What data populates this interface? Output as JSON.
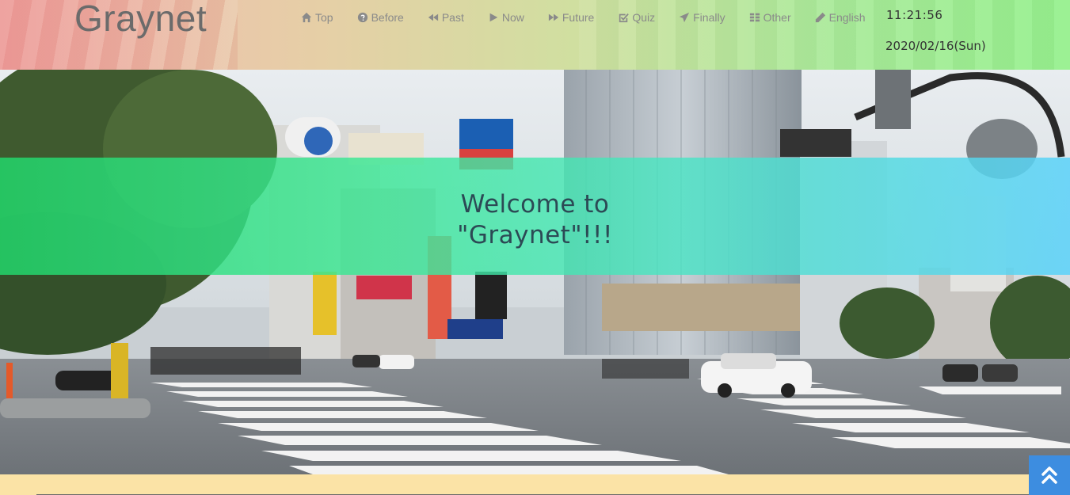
{
  "header": {
    "logo": "Graynet",
    "nav": [
      {
        "label": "Top",
        "icon": "home-icon"
      },
      {
        "label": "Before",
        "icon": "question-circle-icon"
      },
      {
        "label": "Past",
        "icon": "backward-icon"
      },
      {
        "label": "Now",
        "icon": "play-icon"
      },
      {
        "label": "Future",
        "icon": "forward-icon"
      },
      {
        "label": "Quiz",
        "icon": "checkbox-icon"
      },
      {
        "label": "Finally",
        "icon": "send-icon"
      },
      {
        "label": "Other",
        "icon": "grid-icon"
      },
      {
        "label": "English",
        "icon": "pencil-icon"
      }
    ],
    "time": "11:21:56",
    "date": "2020/02/16(Sun)"
  },
  "hero": {
    "line1": "Welcome to",
    "line2": "\"Graynet\"!!!"
  },
  "scroll_top": {
    "icon": "double-chevron-up-icon"
  },
  "colors": {
    "to_top_button": "#3d8de0",
    "footer": "#fbe3a6",
    "banner_left": "#22d66a",
    "banner_right": "#5ad2fa"
  }
}
